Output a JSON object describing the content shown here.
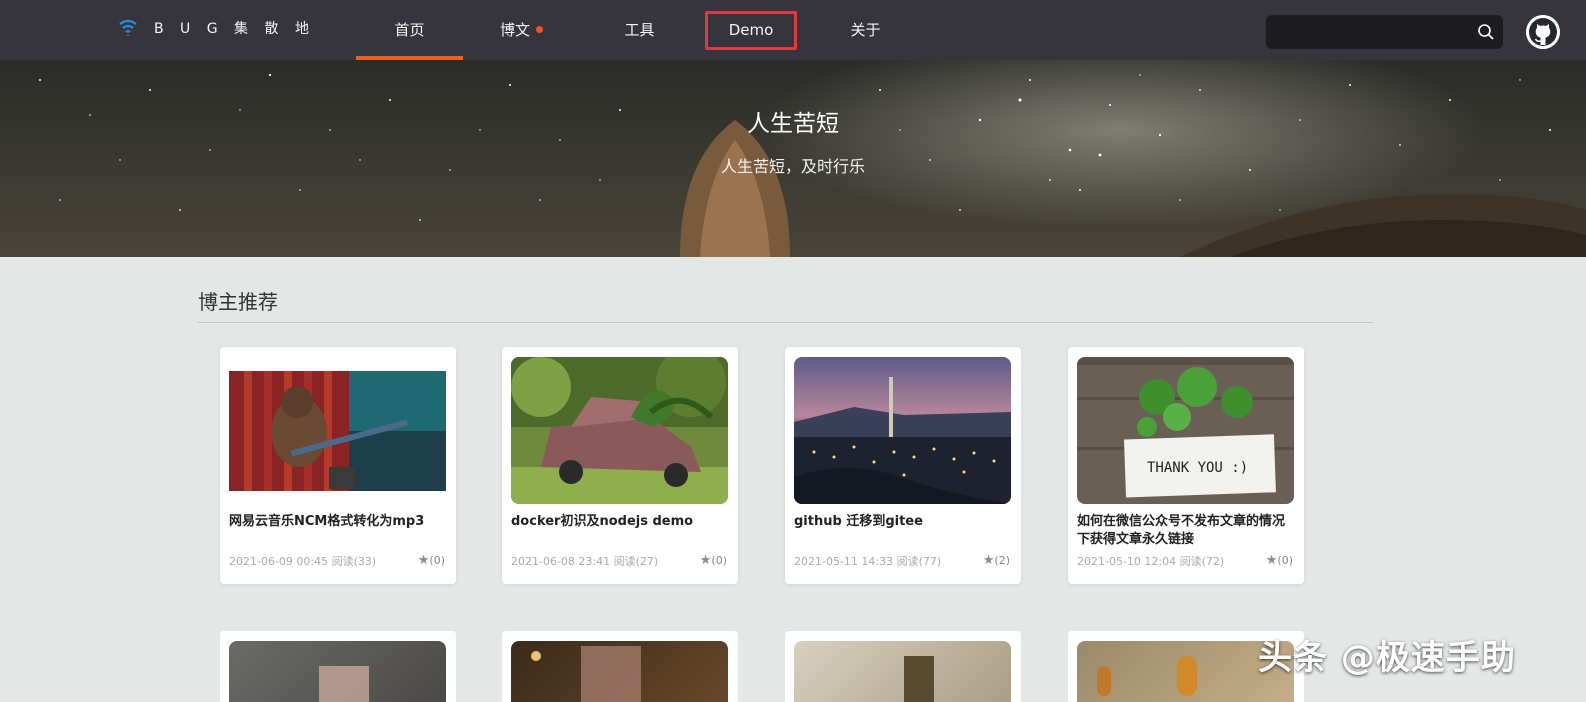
{
  "nav": {
    "logo_text": "B U G 集 散 地",
    "items": [
      {
        "label": "首页",
        "active": true
      },
      {
        "label": "博文",
        "has_dot": true
      },
      {
        "label": "工具"
      },
      {
        "label": "Demo",
        "highlighted": true
      },
      {
        "label": "关于"
      }
    ],
    "search_value": "",
    "accent_color": "#f06115"
  },
  "banner": {
    "title": "人生苦短",
    "subtitle": "人生苦短，及时行乐"
  },
  "section": {
    "title": "博主推荐"
  },
  "cards": [
    {
      "title": "网易云音乐NCM格式转化为mp3",
      "meta": "2021-06-09 00:45 阅读(33)",
      "stars": "(0)",
      "thumb": "gorilla-guitar"
    },
    {
      "title": "docker初识及nodejs demo",
      "meta": "2021-06-08 23:41 阅读(27)",
      "stars": "(0)",
      "thumb": "old-car-plants"
    },
    {
      "title": "github 迁移到gitee",
      "meta": "2021-05-11 14:33 阅读(77)",
      "stars": "(2)",
      "thumb": "industrial-night"
    },
    {
      "title": "如何在微信公众号不发布文章的情况下获得文章永久链接",
      "meta": "2021-05-10 12:04 阅读(72)",
      "stars": "(0)",
      "thumb": "thank-you-plant"
    }
  ],
  "thank_you_text": "THANK YOU :)",
  "watermark": "头条 @极速手助"
}
